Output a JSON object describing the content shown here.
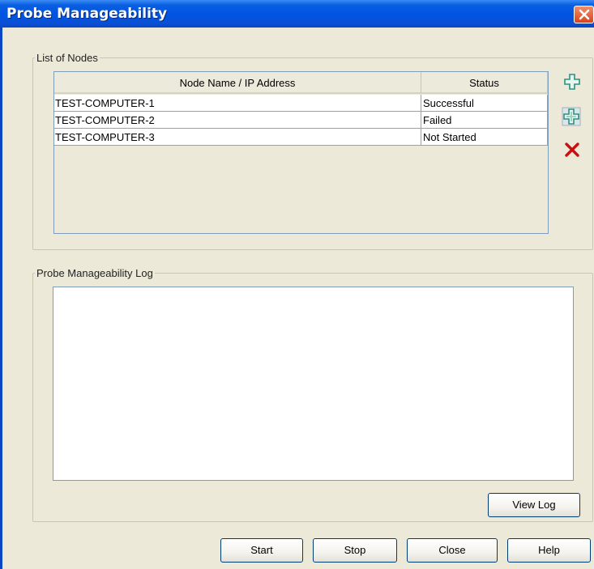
{
  "window": {
    "title": "Probe Manageability"
  },
  "nodes_group": {
    "legend": "List of Nodes",
    "columns": [
      "Node Name / IP Address",
      "Status"
    ],
    "rows": [
      {
        "name": "TEST-COMPUTER-1",
        "status": "Successful"
      },
      {
        "name": "TEST-COMPUTER-2",
        "status": "Failed"
      },
      {
        "name": "TEST-COMPUTER-3",
        "status": "Not Started"
      }
    ],
    "side_icons": [
      "plus-icon",
      "plus-multiple-icon",
      "delete-x-icon"
    ]
  },
  "log_group": {
    "legend": "Probe Manageability Log",
    "log_text": "",
    "view_log_label": "View Log"
  },
  "buttons": {
    "start": "Start",
    "stop": "Stop",
    "close": "Close",
    "help": "Help"
  },
  "colors": {
    "titlebar": "#0054e3",
    "dialog_bg": "#ece9d8",
    "close_button": "#d9421c",
    "plus_icon": "#2f8f7f",
    "delete_icon": "#c81010"
  }
}
